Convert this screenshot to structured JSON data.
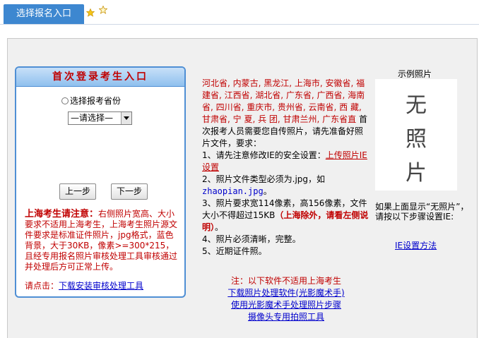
{
  "top": {
    "tab_label": "选择报名入口"
  },
  "login": {
    "header": "首次登录考生入口",
    "radio_label": "选择报考省份",
    "select_value": "—请选择—",
    "prev_button": "上一步",
    "next_button": "下一步",
    "note_title": "上海考生请注意：",
    "note_body": "右侧照片宽高、大小要求不适用上海考生，上海考生照片源文件要求是标准证件照片，jpg格式，蓝色背景，大于30KB，像素>=300*215，且经专用报名照片审核处理工具审核通过并处理后方可正常上传。",
    "note_click": "请点击：",
    "note_link": "下载安装审核处理工具"
  },
  "middle": {
    "provinces": "河北省, 内蒙古, 黑龙江, 上海市, 安徽省, 福建省, 江西省, 湖北省, 广东省, 广西省, 海南省, 四川省, 重庆市, 贵州省, 云南省, 西 藏, 甘肃省, 宁 夏, 兵 团, 甘肃兰州, 广东省直",
    "intro": " 首次报考人员需要您自传照片，请先准备好照片文件，要求：",
    "item1_text": "1、请先注意修改IE的安全设置：",
    "item1_link": "上传照片IE设置",
    "item2_text": "2、照片文件类型必须为.jpg，如",
    "item2_example": "zhaopian.jpg",
    "item2_end": "。",
    "item3_text": "3、照片要求宽114像素，高156像素，文件大小不得超过15KB",
    "item3_red": "（上海除外，请看左侧说明）",
    "item3_end": "。",
    "item4": "4、照片必须清晰，完整。",
    "item5": "5、近期证件照。",
    "notice": "注：以下软件不适用上海考生",
    "link1": "下载照片处理软件(光影魔术手)",
    "link2": "使用光影魔术手处理照片步骤",
    "link3": "摄像头专用拍照工具"
  },
  "right": {
    "sample_title": "示例照片",
    "photo_chars": [
      "无",
      "照",
      "片"
    ],
    "hint": "如果上面显示“无照片”，请按以下步骤设置IE:",
    "ie_link": "IE设置方法"
  },
  "colors": {
    "tab_blue": "#3d87d0",
    "note_red": "#c00000",
    "link_blue": "#0000cc",
    "star_yellow": "#f5c518"
  }
}
